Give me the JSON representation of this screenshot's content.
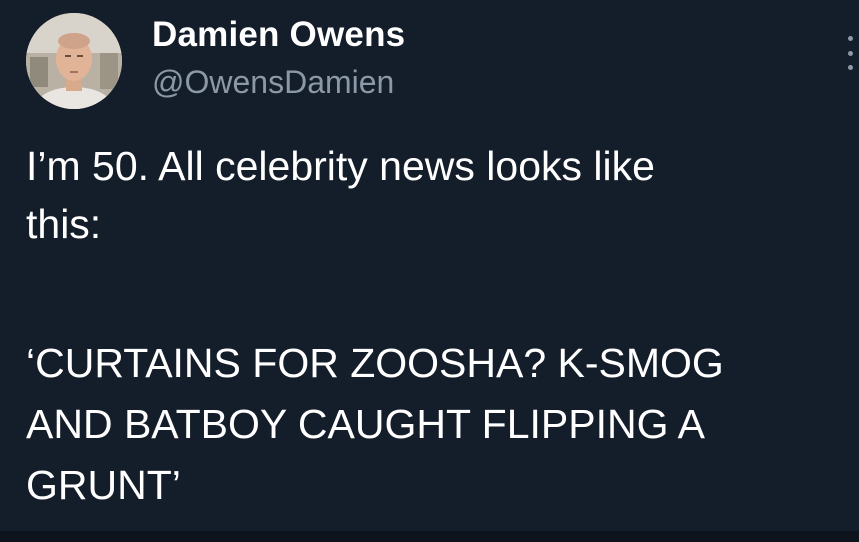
{
  "tweet": {
    "display_name": "Damien Owens",
    "handle": "@OwensDamien",
    "avatar_icon": "profile-photo",
    "more_icon": "vertical-ellipsis-icon",
    "text_lines": "I’m 50. All celebrity news looks like\nthis:",
    "headline_lines": "‘CURTAINS FOR ZOOSHA? K-SMOG\nAND BATBOY CAUGHT FLIPPING A\nGRUNT’"
  },
  "colors": {
    "background": "#141d2a",
    "text": "#ffffff",
    "secondary_text": "#8b98a5"
  }
}
